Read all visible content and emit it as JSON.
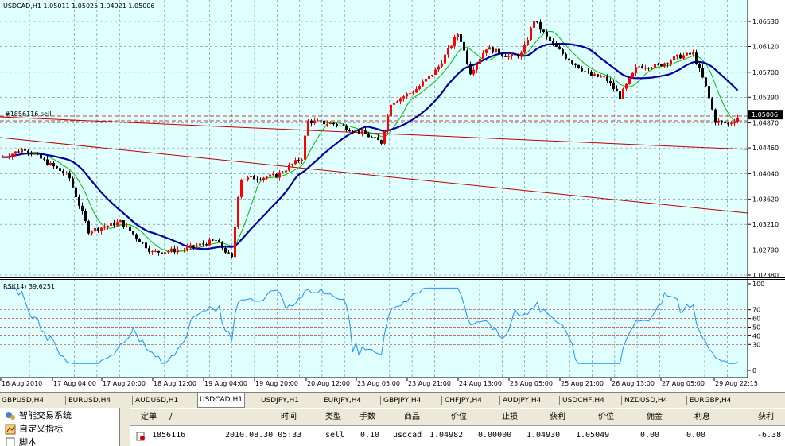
{
  "chart": {
    "header": "USDCAD,H1  1.05011 1.05025 1.04921 1.05006",
    "order_label": "#1856116 sell",
    "current_price": "1.05006",
    "price_ticks": [
      "1.06530",
      "1.06120",
      "1.05700",
      "1.05290",
      "1.04870",
      "1.04460",
      "1.04040",
      "1.03620",
      "1.03210",
      "1.02790",
      "1.02380"
    ],
    "rsi_label": "RSI(14) 39.6251",
    "rsi_ticks": [
      "100",
      "70",
      "60",
      "50",
      "40",
      "30",
      "0"
    ],
    "time_ticks": [
      "16 Aug 2010",
      "17 Aug 04:00",
      "17 Aug 20:00",
      "18 Aug 12:00",
      "19 Aug 04:00",
      "19 Aug 20:00",
      "20 Aug 12:00",
      "23 Aug 05:00",
      "23 Aug 21:00",
      "24 Aug 13:00",
      "25 Aug 05:00",
      "25 Aug 21:00",
      "26 Aug 13:00",
      "27 Aug 05:00",
      "29 Aug 22:15"
    ],
    "colors": {
      "bg": "#e0ffff",
      "bull": "#ff0000",
      "bear": "#000000",
      "ma_fast": "#00c000",
      "ma_slow": "#0000a0",
      "rsi": "#1e90ff",
      "trend": "#c00000"
    }
  },
  "tabs": [
    "GBPUSD,H4",
    "EURUSD,H4",
    "AUDUSD,H1",
    "USDCAD,H1",
    "USDJPY,H1",
    "EURJPY,H4",
    "GBPJPY,H4",
    "CHFJPY,H4",
    "AUDJPY,H4",
    "USDCHF,H4",
    "NZDUSD,H4",
    "EURGBP,H4"
  ],
  "active_tab": "USDCAD,H1",
  "navigator": {
    "items": [
      {
        "label": "智能交易系统",
        "icon": "expert-advisor-icon"
      },
      {
        "label": "自定义指标",
        "icon": "custom-indicator-icon"
      },
      {
        "label": "脚本",
        "icon": "script-icon"
      }
    ]
  },
  "terminal": {
    "headers": [
      "定单",
      "/",
      "时间",
      "类型",
      "手数",
      "商品",
      "价位",
      "止损",
      "获利",
      "价位",
      "佣金",
      "利息",
      "获利"
    ],
    "row": [
      "1856116",
      "2010.08.30 05:33",
      "sell",
      "0.10",
      "usdcad",
      "1.04982",
      "0.00000",
      "1.04930",
      "1.05049",
      "0.00",
      "0.00",
      "-6.38"
    ]
  }
}
